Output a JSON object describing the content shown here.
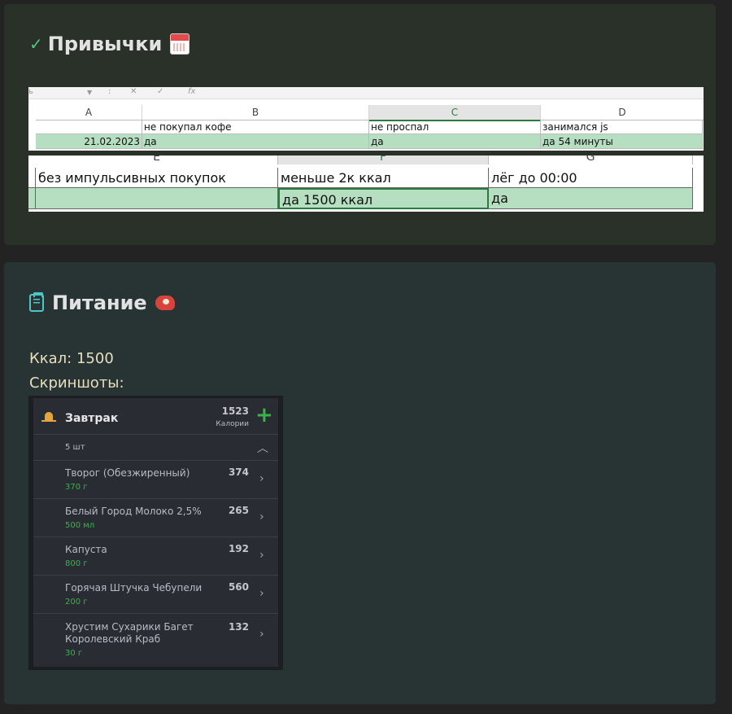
{
  "habits": {
    "title": "Привычки",
    "sheet_top": {
      "formula_bar": {
        "left": "ь",
        "sep": ":",
        "x": "✕",
        "check": "✓",
        "fx": "fx"
      },
      "columns": [
        "A",
        "B",
        "C",
        "D"
      ],
      "headers": [
        "",
        "не покупал кофе",
        "не проспал",
        "занимался js"
      ],
      "row": [
        "21.02.2023",
        "да",
        "да",
        "да 54 минуты"
      ]
    },
    "sheet_bottom": {
      "columns": [
        "E",
        "F",
        "G"
      ],
      "headers": [
        "без импульсивных покупок",
        "меньше 2к ккал",
        "лёг до 00:00"
      ],
      "row": [
        "",
        "да 1500 ккал",
        "да"
      ]
    }
  },
  "food": {
    "title": "Питание",
    "kcal": "Ккал: 1500",
    "screens_label": "Скриншоты:",
    "meal": {
      "name": "Завтрак",
      "total": "1523",
      "total_label": "Калории",
      "count": "5 шт",
      "items": [
        {
          "name": "Творог (Обезжиренный)",
          "name2": "",
          "amount": "370 г",
          "kcal": "374"
        },
        {
          "name": "Белый Город Молоко 2,5%",
          "name2": "",
          "amount": "500 мл",
          "kcal": "265"
        },
        {
          "name": "Капуста",
          "name2": "",
          "amount": "800 г",
          "kcal": "192"
        },
        {
          "name": "Горячая Штучка Чебупели",
          "name2": "",
          "amount": "200 г",
          "kcal": "560"
        },
        {
          "name": "Хрустим Сухарики Багет",
          "name2": "Королевский Краб",
          "amount": "30 г",
          "kcal": "132"
        }
      ]
    }
  },
  "colors": {
    "habits_bg": "#2a3128",
    "food_bg": "#283434",
    "sheet_green": "#b6dfc2",
    "accent_green": "#39b34a"
  }
}
